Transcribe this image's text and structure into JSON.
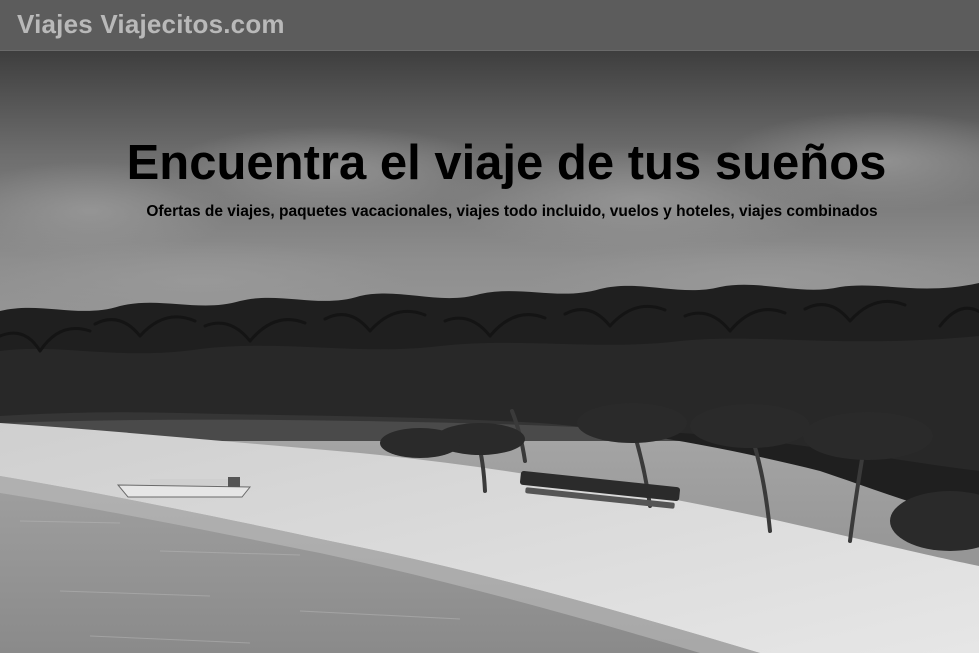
{
  "header": {
    "brand": "Viajes Viajecitos.com"
  },
  "hero": {
    "title": "Encuentra el viaje de tus sueños",
    "subtitle": "Ofertas de viajes, paquetes vacacionales, viajes todo incluido, vuelos y hoteles, viajes combinados",
    "image_subject": "tropical beach with palm trees and boat"
  },
  "colors": {
    "topbar_bg": "#5c5c5c",
    "brand_text": "#b9b9b9",
    "hero_text": "#000000"
  }
}
